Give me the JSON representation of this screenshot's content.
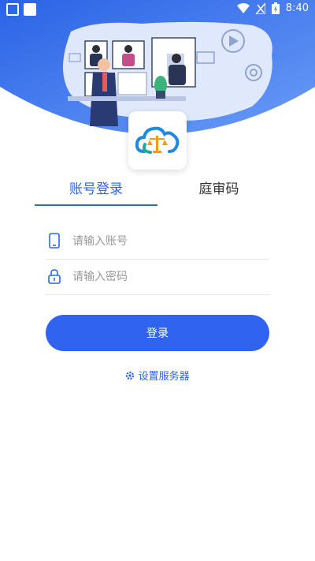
{
  "status_bar": {
    "time": "8:40"
  },
  "tabs": [
    {
      "label": "账号登录",
      "active": true
    },
    {
      "label": "庭审码",
      "active": false
    }
  ],
  "account_field": {
    "placeholder": "请输入账号",
    "value": ""
  },
  "password_field": {
    "placeholder": "请输入密码",
    "value": ""
  },
  "login_button": {
    "label": "登录"
  },
  "server_settings": {
    "label": "设置服务器",
    "icon": "gear-icon"
  },
  "colors": {
    "primary": "#2f63f0",
    "hero_gradient_top": "#2d6ce6",
    "hero_gradient_bottom": "#5a8ff5"
  }
}
